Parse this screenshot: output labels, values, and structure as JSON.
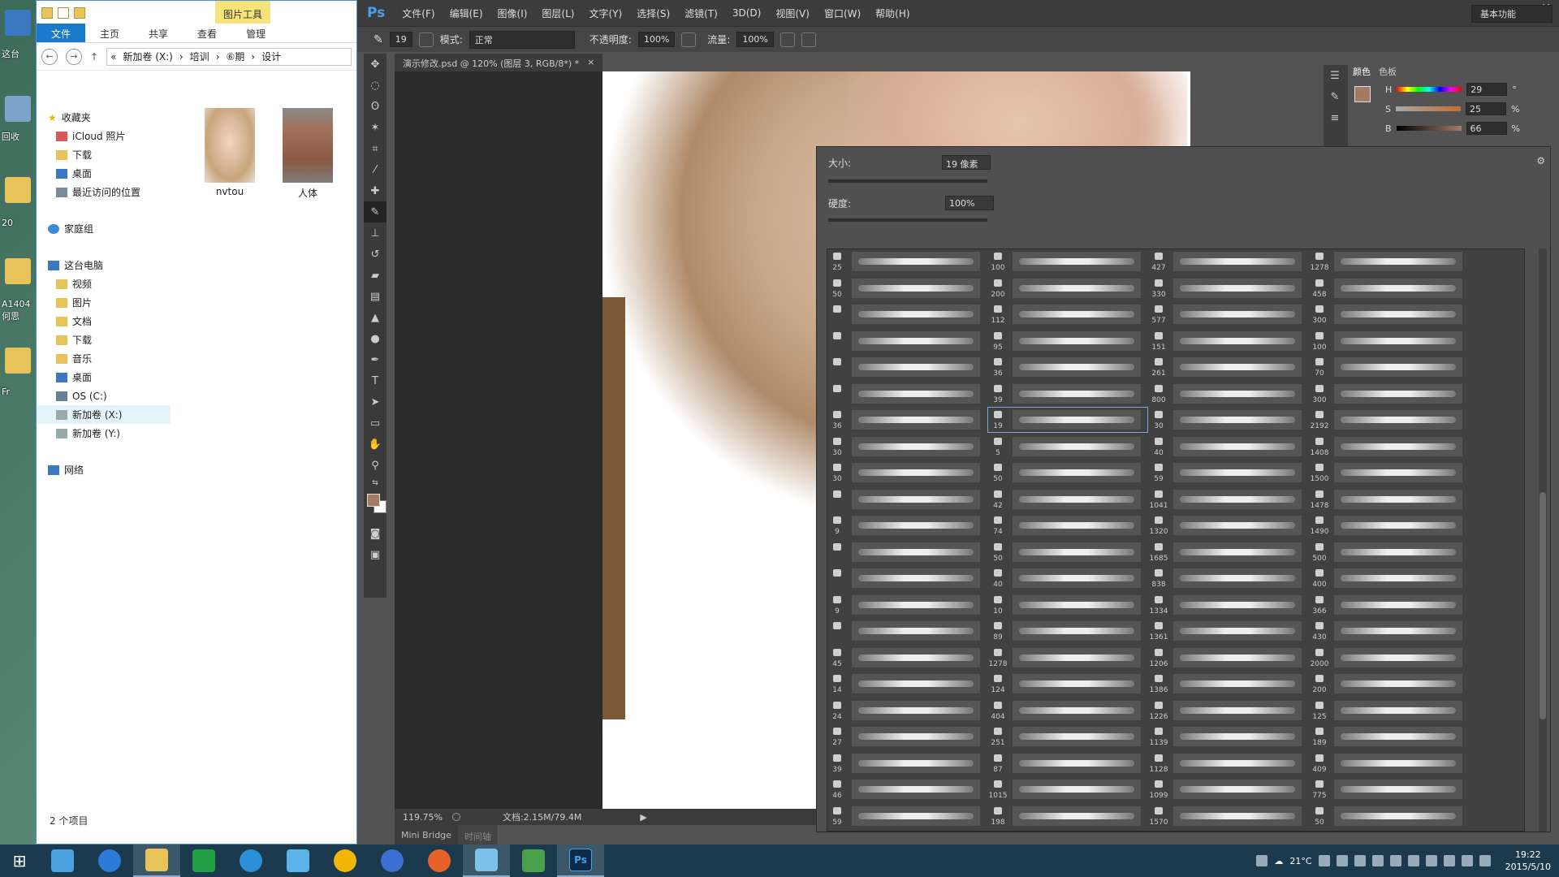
{
  "desktop": {
    "labels": [
      "这台",
      "回收",
      "20",
      "A1404\n何思",
      "Fr"
    ]
  },
  "explorer": {
    "picture_tools": "图片工具",
    "tabs": [
      "文件",
      "主页",
      "共享",
      "查看",
      "管理"
    ],
    "address": {
      "prefix": "«",
      "crumbs": [
        "新加卷 (X:)",
        "培训",
        "⑥期",
        "设计"
      ]
    },
    "nav": {
      "favorites": "收藏夹",
      "fav_items": [
        "iCloud 照片",
        "下载",
        "桌面",
        "最近访问的位置"
      ],
      "homegroup": "家庭组",
      "this_pc": "这台电脑",
      "pc_items": [
        "视频",
        "图片",
        "文档",
        "下载",
        "音乐",
        "桌面",
        "OS (C:)",
        "新加卷 (X:)",
        "新加卷 (Y:)"
      ],
      "network": "网络"
    },
    "files": [
      {
        "name": "nvtou"
      },
      {
        "name": "人体"
      }
    ],
    "status": "2 个项目"
  },
  "photoshop": {
    "logo": "Ps",
    "menu": [
      "文件(F)",
      "编辑(E)",
      "图像(I)",
      "图层(L)",
      "文字(Y)",
      "选择(S)",
      "滤镜(T)",
      "3D(D)",
      "视图(V)",
      "窗口(W)",
      "帮助(H)"
    ],
    "options": {
      "brush_size": "19",
      "mode_label": "模式:",
      "mode_value": "正常",
      "opacity_label": "不透明度:",
      "opacity_value": "100%",
      "flow_label": "流量:",
      "flow_value": "100%",
      "workspace": "基本功能"
    },
    "doc_tab": "演示修改.psd @ 120% (图层 3, RGB/8*) *",
    "doc_close": "×",
    "status": {
      "zoom": "119.75%",
      "doc_info": "文档:2.15M/79.4M"
    },
    "bottom_tabs": [
      "Mini Bridge",
      "时间轴"
    ],
    "color_panel": {
      "tabs": [
        "颜色",
        "色板"
      ],
      "h_label": "H",
      "h_value": "29",
      "h_unit": "°",
      "s_label": "S",
      "s_value": "25",
      "s_unit": "%",
      "b_label": "B",
      "b_value": "66",
      "b_unit": "%",
      "fg_color": "#a47b62"
    },
    "brush_picker": {
      "size_label": "大小:",
      "size_value": "19 像素",
      "hardness_label": "硬度:",
      "hardness_value": "100%",
      "columns": [
        [
          "25",
          "50",
          "",
          "",
          "",
          "",
          "36",
          "30",
          "30",
          "",
          "9",
          "",
          "",
          "9",
          "",
          "45",
          "14",
          "24",
          "27",
          "39",
          "46",
          "59"
        ],
        [
          "100",
          "200",
          "112",
          "95",
          "36",
          "39",
          "19",
          "5",
          "50",
          "42",
          "74",
          "50",
          "40",
          "10",
          "89",
          "1278",
          "124",
          "404",
          "251",
          "87",
          "1015",
          "198"
        ],
        [
          "427",
          "330",
          "577",
          "151",
          "261",
          "800",
          "30",
          "40",
          "59",
          "1041",
          "1320",
          "1685",
          "838",
          "1334",
          "1361",
          "1206",
          "1386",
          "1226",
          "1139",
          "1128",
          "1099",
          "1570"
        ],
        [
          "1278",
          "458",
          "300",
          "100",
          "70",
          "300",
          "2192",
          "1408",
          "1500",
          "1478",
          "1490",
          "500",
          "400",
          "366",
          "430",
          "2000",
          "200",
          "125",
          "189",
          "409",
          "775",
          "50"
        ]
      ],
      "selected": "19"
    }
  },
  "taskbar": {
    "weather": "21°C",
    "time": "19:22",
    "date": "2015/5/10"
  }
}
